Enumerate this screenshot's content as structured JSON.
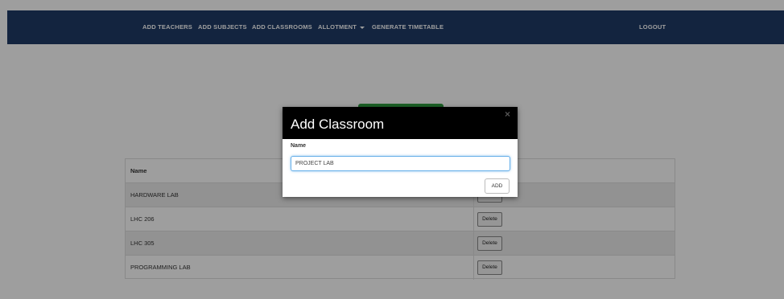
{
  "navbar": {
    "items": [
      {
        "label": "ADD TEACHERS"
      },
      {
        "label": "ADD SUBJECTS"
      },
      {
        "label": "ADD CLASSROOMS"
      },
      {
        "label": "ALLOTMENT"
      },
      {
        "label": "GENERATE TIMETABLE"
      }
    ],
    "logout": "LOGOUT"
  },
  "table": {
    "header": "Name",
    "rows": [
      {
        "name": "HARDWARE LAB",
        "action": "Delete"
      },
      {
        "name": "LHC 206",
        "action": "Delete"
      },
      {
        "name": "LHC 305",
        "action": "Delete"
      },
      {
        "name": "PROGRAMMING LAB",
        "action": "Delete"
      }
    ]
  },
  "modal": {
    "title": "Add Classroom",
    "close_symbol": "×",
    "field_label": "Name",
    "field_value": "PROJECT LAB",
    "add_label": "ADD"
  },
  "colors": {
    "navbar": "#1f3a66",
    "green_button": "#2e9b3e",
    "modal_header": "#000000",
    "input_focus": "#66afe9"
  }
}
